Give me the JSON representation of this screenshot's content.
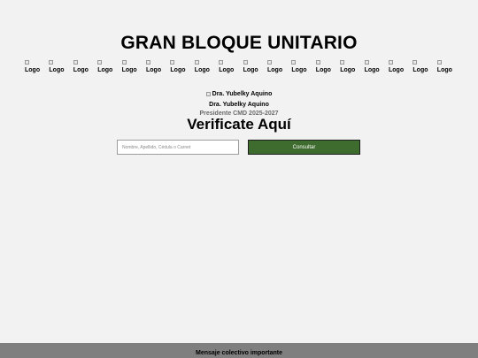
{
  "header": {
    "title": "GRAN BLOQUE UNITARIO"
  },
  "logos": {
    "alt": "Logo",
    "count": 18,
    "icon": "broken-image-icon"
  },
  "president": {
    "image_alt": "Dra. Yubelky Aquino",
    "name": "Dra. Yubelky Aquino",
    "role": "Presidente CMD 2025-2027"
  },
  "verify": {
    "title": "Verificate Aquí",
    "search_value": "",
    "search_placeholder": "Nombre, Apellido, Cédula o Carnet",
    "button_label": "Consultar"
  },
  "colors": {
    "background": "#f2f2f2",
    "button": "#3e6b2e",
    "footer": "#7f7f7f"
  },
  "footer": {
    "text": "Mensaje colectivo importante"
  }
}
